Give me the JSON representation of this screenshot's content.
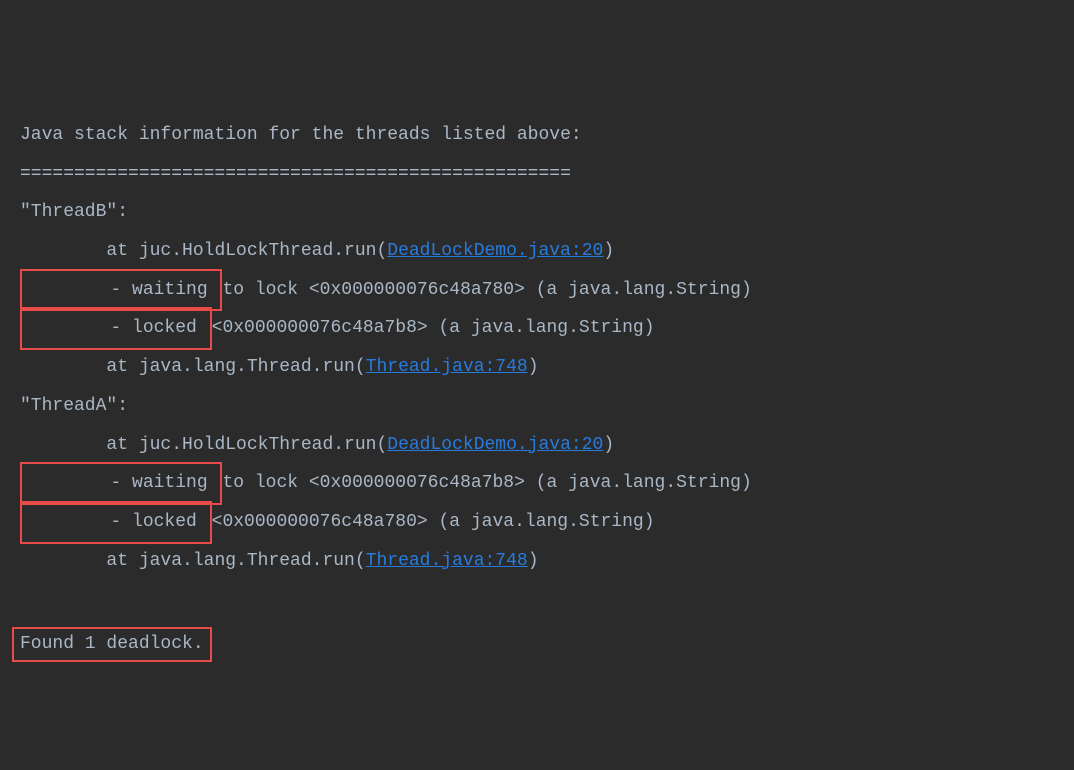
{
  "header": {
    "title": "Java stack information for the threads listed above:",
    "separator": "==================================================="
  },
  "threads": [
    {
      "name": "\"ThreadB\":",
      "at1_prefix": "\tat juc.HoldLockThread.run(",
      "at1_link": "DeadLockDemo.java:20",
      "at1_suffix": ")",
      "boxed1": "\t- waiting ",
      "waiting_rest": "to lock <0x000000076c48a780> (a java.lang.String)",
      "boxed2": "\t- locked ",
      "locked_rest": "<0x000000076c48a7b8> (a java.lang.String)",
      "at2_prefix": "\tat java.lang.Thread.run(",
      "at2_link": "Thread.java:748",
      "at2_suffix": ")"
    },
    {
      "name": "\"ThreadA\":",
      "at1_prefix": "\tat juc.HoldLockThread.run(",
      "at1_link": "DeadLockDemo.java:20",
      "at1_suffix": ")",
      "boxed1": "\t- waiting ",
      "waiting_rest": "to lock <0x000000076c48a7b8> (a java.lang.String)",
      "boxed2": "\t- locked ",
      "locked_rest": "<0x000000076c48a780> (a java.lang.String)",
      "at2_prefix": "\tat java.lang.Thread.run(",
      "at2_link": "Thread.java:748",
      "at2_suffix": ")"
    }
  ],
  "summary": "Found 1 deadlock."
}
